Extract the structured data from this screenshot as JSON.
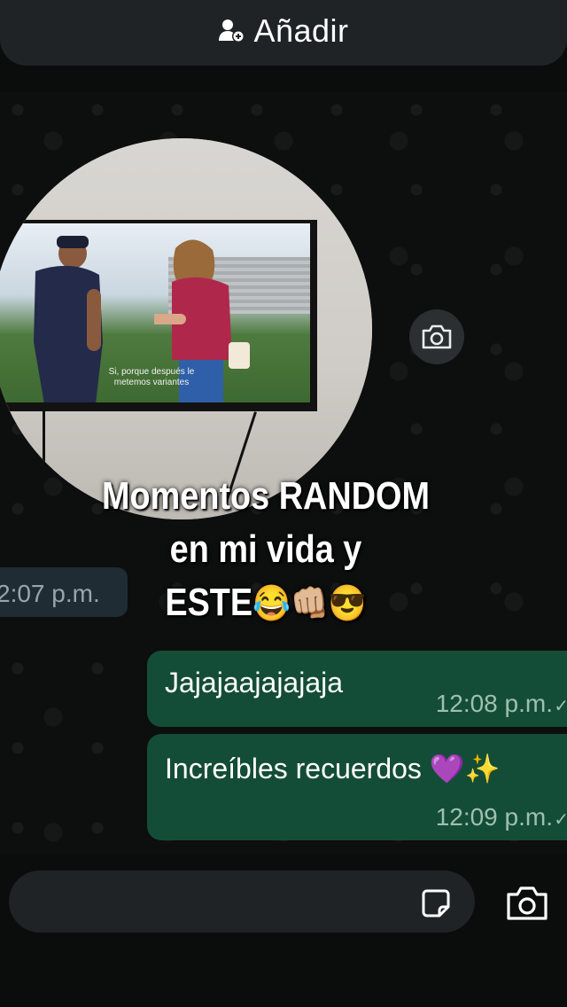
{
  "header": {
    "add_label": "Añadir",
    "add_icon": "add-contact-icon"
  },
  "video": {
    "subtitle": "Si, porque después le metemos variantes",
    "camera_icon": "camera-icon"
  },
  "caption": {
    "line1": "Momentos RANDOM",
    "line2": "en mi vida y",
    "line3_text": "ESTE",
    "line3_emojis": "😂👊🏼😎"
  },
  "messages": {
    "incoming_time": "2:07 p.m.",
    "outgoing": [
      {
        "text": "Jajajaajajajaja",
        "time": "12:08 p.m.",
        "status": "✓"
      },
      {
        "text": "Increíbles recuerdos 💜✨",
        "time": "12:09 p.m.",
        "status": "✓"
      }
    ]
  },
  "composer": {
    "placeholder": "",
    "sticker_icon": "sticker-icon",
    "camera_icon": "camera-icon"
  },
  "colors": {
    "outgoing_bubble": "#144d37",
    "incoming_bubble": "#202c33",
    "background": "#0b0c0c"
  }
}
